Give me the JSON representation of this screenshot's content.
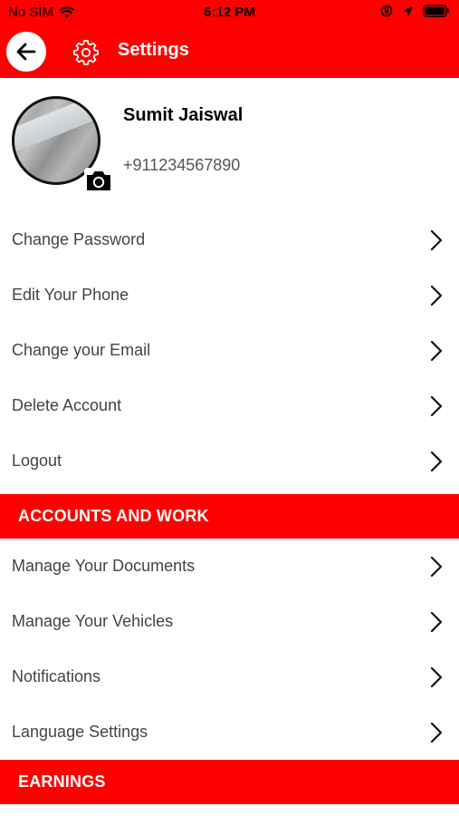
{
  "status_bar": {
    "carrier": "No SIM",
    "time": "6:12 PM",
    "icons": [
      "wifi-icon",
      "orientation-lock-icon",
      "location-arrow-icon",
      "battery-icon"
    ]
  },
  "header": {
    "title": "Settings",
    "icons": [
      "back-arrow-icon",
      "gear-icon"
    ]
  },
  "profile": {
    "name": "Sumit Jaiswal",
    "phone": "+911234567890"
  },
  "account_items": [
    {
      "label": "Change Password"
    },
    {
      "label": "Edit Your Phone"
    },
    {
      "label": "Change your Email"
    },
    {
      "label": "Delete Account"
    },
    {
      "label": "Logout"
    }
  ],
  "accounts_and_work": {
    "title": "ACCOUNTS AND WORK",
    "items": [
      {
        "label": "Manage Your Documents"
      },
      {
        "label": "Manage Your Vehicles"
      },
      {
        "label": "Notifications"
      },
      {
        "label": "Language Settings"
      }
    ]
  },
  "earnings": {
    "title": "EARNINGS"
  },
  "colors": {
    "accent": "#ff0000",
    "text": "#444444",
    "background": "#ffffff"
  }
}
